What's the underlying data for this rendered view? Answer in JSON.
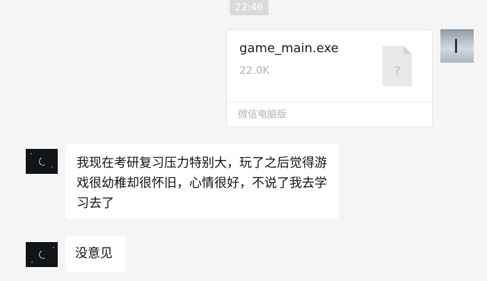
{
  "chat": {
    "timestamp": "22:46",
    "file_message": {
      "file_name": "game_main.exe",
      "file_size": "22.0K",
      "source": "微信电脑版",
      "icon": "unknown-file-icon",
      "icon_glyph": "?"
    },
    "messages": [
      {
        "sender": "other",
        "text": "我现在考研复习压力特别大，玩了之后觉得游戏很幼稚却很怀旧，心情很好，不说了我去学习去了"
      },
      {
        "sender": "other",
        "text": "没意见"
      }
    ]
  }
}
